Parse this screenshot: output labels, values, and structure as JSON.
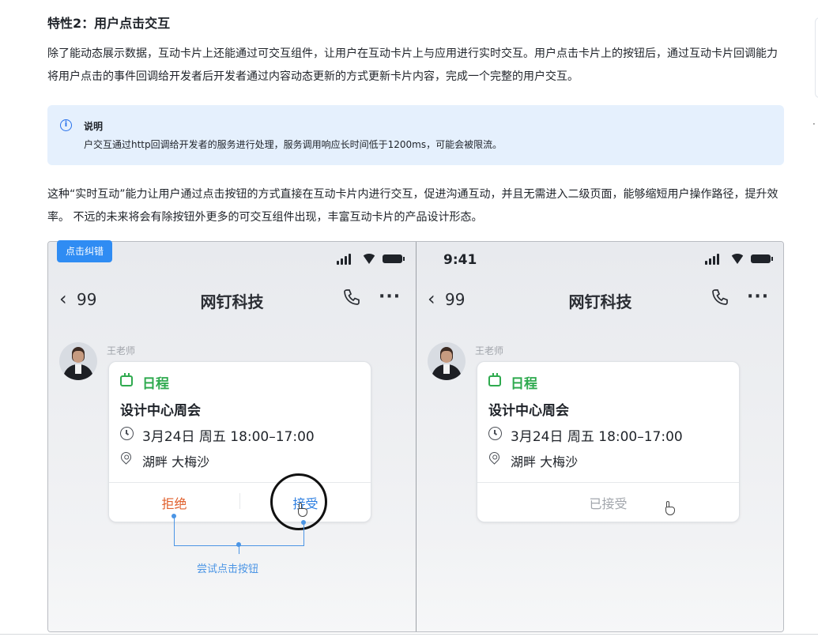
{
  "section": {
    "heading": "特性2：用户点击交互",
    "para1": "除了能动态展示数据，互动卡片上还能通过可交互组件，让用户在互动卡片上与应用进行实时交互。用户点击卡片上的按钮后，通过互动卡片回调能力将用户点击的事件回调给开发者后开发者通过内容动态更新的方式更新卡片内容，完成一个完整的用户交互。",
    "para2": "这种“实时互动”能力让用户通过点击按钮的方式直接在互动卡片内进行交互，促进沟通互动，并且无需进入二级页面，能够缩短用户操作路径，提升效率。 不远的未来将会有除按钮外更多的可交互组件出现，丰富互动卡片的产品设计形态。"
  },
  "note": {
    "icon": "info-icon",
    "title": "说明",
    "text": "户交互通过http回调给开发者的服务进行处理，服务调用响应长时间低于1200ms，可能会被限流。"
  },
  "figure": {
    "report_button": "点击纠错",
    "phones": [
      {
        "time": "",
        "back_count": "99",
        "chat_title": "网钉科技",
        "sender": "王老师",
        "card_label": "日程",
        "card_title": "设计中心周会",
        "card_time": "3月24日 周五 18:00–17:00",
        "card_location": "湖畔 大梅沙",
        "reject_label": "拒绝",
        "accept_label": "接受",
        "guide_text": "尝试点击按钮"
      },
      {
        "time": "9:41",
        "back_count": "99",
        "chat_title": "网钉科技",
        "sender": "王老师",
        "card_label": "日程",
        "card_title": "设计中心周会",
        "card_time": "3月24日 周五 18:00–17:00",
        "card_location": "湖畔 大梅沙",
        "accepted_label": "已接受"
      }
    ]
  },
  "colors": {
    "accent": "#2f8cf3",
    "note_bg": "#e5f0fd",
    "calendar_green": "#2faa4f",
    "reject_orange": "#e0602d"
  }
}
